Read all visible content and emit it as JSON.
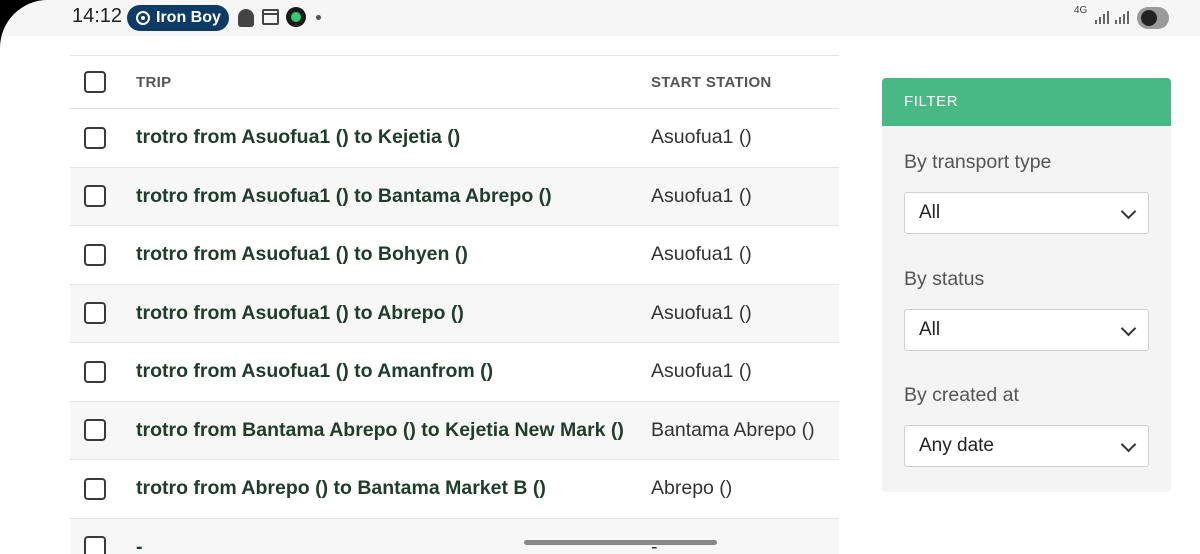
{
  "status_bar": {
    "time": "14:12",
    "app_pill": "Iron Boy",
    "network": "4G",
    "icons": [
      "record-icon",
      "snapchat-icon",
      "calendar-icon",
      "app-icon",
      "notification-dot-icon",
      "signal-icon",
      "toggle-icon"
    ]
  },
  "table": {
    "headers": {
      "trip": "TRIP",
      "start_station": "START STATION"
    },
    "rows": [
      {
        "trip": "trotro from Asuofua1 () to Kejetia ()",
        "start": "Asuofua1 ()"
      },
      {
        "trip": "trotro from Asuofua1 () to Bantama Abrepo ()",
        "start": "Asuofua1 ()"
      },
      {
        "trip": "trotro from Asuofua1 () to Bohyen ()",
        "start": "Asuofua1 ()"
      },
      {
        "trip": "trotro from Asuofua1 () to Abrepo ()",
        "start": "Asuofua1 ()"
      },
      {
        "trip": "trotro from Asuofua1 () to Amanfrom ()",
        "start": "Asuofua1 ()"
      },
      {
        "trip": "trotro from Bantama Abrepo () to Kejetia New Mark ()",
        "start": "Bantama Abrepo ()"
      },
      {
        "trip": "trotro from Abrepo () to Bantama Market B ()",
        "start": "Abrepo ()"
      },
      {
        "trip": "-",
        "start": "-"
      }
    ]
  },
  "filter": {
    "title": "FILTER",
    "transport_type": {
      "label": "By transport type",
      "value": "All"
    },
    "status": {
      "label": "By status",
      "value": "All"
    },
    "created_at": {
      "label": "By created at",
      "value": "Any date"
    }
  },
  "colors": {
    "filter_header": "#48b884",
    "trip_text": "#1f3d2b",
    "pill": "#0d3b66"
  }
}
